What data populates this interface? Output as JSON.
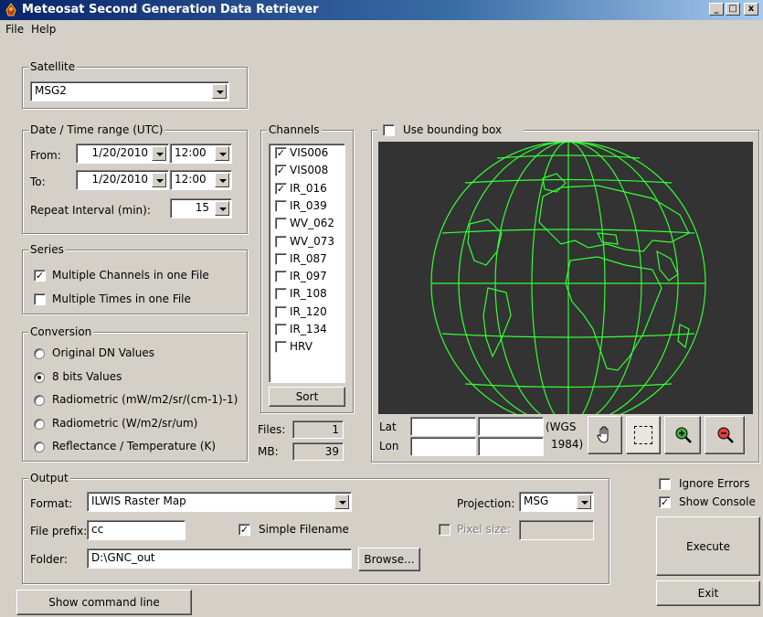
{
  "window": {
    "title": "Meteosat Second Generation Data Retriever",
    "minimize": "_",
    "maximize": "□",
    "close": "x"
  },
  "menu": [
    "File",
    "Help"
  ],
  "satellite": {
    "label": "Satellite",
    "value": "MSG2"
  },
  "datetime": {
    "label": "Date / Time range (UTC)",
    "from_label": "From:",
    "from_date": "1/20/2010",
    "from_time": "12:00",
    "to_label": "To:",
    "to_date": "1/20/2010",
    "to_time": "12:00",
    "repeat_label": "Repeat Interval (min):",
    "repeat_value": "15"
  },
  "series": {
    "label": "Series",
    "multi_channels": "Multiple Channels in one File",
    "multi_times": "Multiple Times in one File"
  },
  "conversion": {
    "label": "Conversion",
    "options": [
      "Original DN Values",
      "8 bits Values",
      "Radiometric (mW/m2/sr/(cm-1)-1)",
      "Radiometric (W/m2/sr/um)",
      "Reflectance / Temperature (K)"
    ],
    "selected": "8 bits Values"
  },
  "channels": {
    "label": "Channels",
    "items": [
      {
        "name": "VIS006",
        "checked": true
      },
      {
        "name": "VIS008",
        "checked": true
      },
      {
        "name": "IR_016",
        "checked": true
      },
      {
        "name": "IR_039",
        "checked": false
      },
      {
        "name": "WV_062",
        "checked": false
      },
      {
        "name": "WV_073",
        "checked": false
      },
      {
        "name": "IR_087",
        "checked": false
      },
      {
        "name": "IR_097",
        "checked": false
      },
      {
        "name": "IR_108",
        "checked": false
      },
      {
        "name": "IR_120",
        "checked": false
      },
      {
        "name": "IR_134",
        "checked": false
      },
      {
        "name": "HRV",
        "checked": false
      }
    ],
    "sort_label": "Sort"
  },
  "stats": {
    "files_label": "Files:",
    "files_value": "1",
    "mb_label": "MB:",
    "mb_value": "39"
  },
  "bbox": {
    "label": "Use bounding box",
    "lat_label": "Lat",
    "lon_label": "Lon",
    "datum_line1": "(WGS",
    "datum_line2": "1984)"
  },
  "output": {
    "label": "Output",
    "format_label": "Format:",
    "format_value": "ILWIS Raster Map",
    "projection_label": "Projection:",
    "projection_value": "MSG",
    "prefix_label": "File prefix:",
    "prefix_value": "cc",
    "simple_filename": "Simple Filename",
    "pixel_size_label": "Pixel size:",
    "folder_label": "Folder:",
    "folder_value": "D:\\GNC_out",
    "browse_label": "Browse..."
  },
  "options": {
    "ignore_errors": "Ignore Errors",
    "show_console": "Show Console"
  },
  "buttons": {
    "execute": "Execute",
    "exit": "Exit",
    "show_cmd": "Show command line"
  },
  "colors": {
    "map_background": "#333333",
    "map_lines": "#33ff33",
    "titlebar": "#0a246a"
  }
}
